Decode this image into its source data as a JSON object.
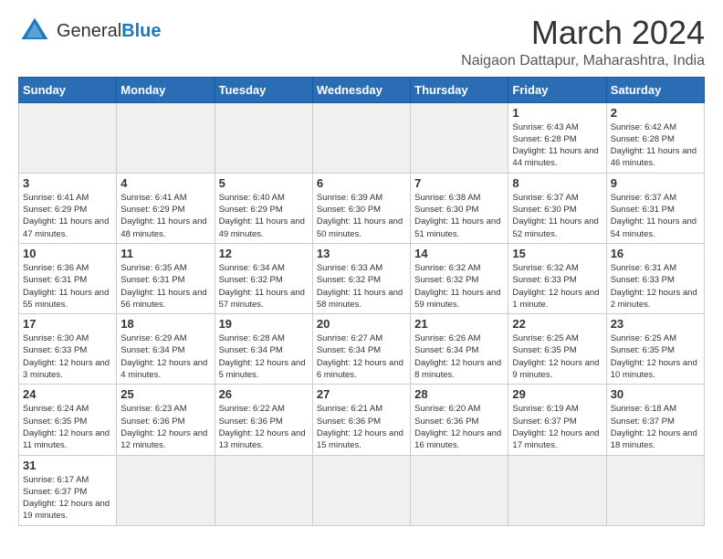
{
  "header": {
    "logo_general": "General",
    "logo_blue": "Blue",
    "month_year": "March 2024",
    "location": "Naigaon Dattapur, Maharashtra, India"
  },
  "days_of_week": [
    "Sunday",
    "Monday",
    "Tuesday",
    "Wednesday",
    "Thursday",
    "Friday",
    "Saturday"
  ],
  "weeks": [
    [
      {
        "day": "",
        "info": ""
      },
      {
        "day": "",
        "info": ""
      },
      {
        "day": "",
        "info": ""
      },
      {
        "day": "",
        "info": ""
      },
      {
        "day": "",
        "info": ""
      },
      {
        "day": "1",
        "info": "Sunrise: 6:43 AM\nSunset: 6:28 PM\nDaylight: 11 hours\nand 44 minutes."
      },
      {
        "day": "2",
        "info": "Sunrise: 6:42 AM\nSunset: 6:28 PM\nDaylight: 11 hours\nand 46 minutes."
      }
    ],
    [
      {
        "day": "3",
        "info": "Sunrise: 6:41 AM\nSunset: 6:29 PM\nDaylight: 11 hours\nand 47 minutes."
      },
      {
        "day": "4",
        "info": "Sunrise: 6:41 AM\nSunset: 6:29 PM\nDaylight: 11 hours\nand 48 minutes."
      },
      {
        "day": "5",
        "info": "Sunrise: 6:40 AM\nSunset: 6:29 PM\nDaylight: 11 hours\nand 49 minutes."
      },
      {
        "day": "6",
        "info": "Sunrise: 6:39 AM\nSunset: 6:30 PM\nDaylight: 11 hours\nand 50 minutes."
      },
      {
        "day": "7",
        "info": "Sunrise: 6:38 AM\nSunset: 6:30 PM\nDaylight: 11 hours\nand 51 minutes."
      },
      {
        "day": "8",
        "info": "Sunrise: 6:37 AM\nSunset: 6:30 PM\nDaylight: 11 hours\nand 52 minutes."
      },
      {
        "day": "9",
        "info": "Sunrise: 6:37 AM\nSunset: 6:31 PM\nDaylight: 11 hours\nand 54 minutes."
      }
    ],
    [
      {
        "day": "10",
        "info": "Sunrise: 6:36 AM\nSunset: 6:31 PM\nDaylight: 11 hours\nand 55 minutes."
      },
      {
        "day": "11",
        "info": "Sunrise: 6:35 AM\nSunset: 6:31 PM\nDaylight: 11 hours\nand 56 minutes."
      },
      {
        "day": "12",
        "info": "Sunrise: 6:34 AM\nSunset: 6:32 PM\nDaylight: 11 hours\nand 57 minutes."
      },
      {
        "day": "13",
        "info": "Sunrise: 6:33 AM\nSunset: 6:32 PM\nDaylight: 11 hours\nand 58 minutes."
      },
      {
        "day": "14",
        "info": "Sunrise: 6:32 AM\nSunset: 6:32 PM\nDaylight: 11 hours\nand 59 minutes."
      },
      {
        "day": "15",
        "info": "Sunrise: 6:32 AM\nSunset: 6:33 PM\nDaylight: 12 hours\nand 1 minute."
      },
      {
        "day": "16",
        "info": "Sunrise: 6:31 AM\nSunset: 6:33 PM\nDaylight: 12 hours\nand 2 minutes."
      }
    ],
    [
      {
        "day": "17",
        "info": "Sunrise: 6:30 AM\nSunset: 6:33 PM\nDaylight: 12 hours\nand 3 minutes."
      },
      {
        "day": "18",
        "info": "Sunrise: 6:29 AM\nSunset: 6:34 PM\nDaylight: 12 hours\nand 4 minutes."
      },
      {
        "day": "19",
        "info": "Sunrise: 6:28 AM\nSunset: 6:34 PM\nDaylight: 12 hours\nand 5 minutes."
      },
      {
        "day": "20",
        "info": "Sunrise: 6:27 AM\nSunset: 6:34 PM\nDaylight: 12 hours\nand 6 minutes."
      },
      {
        "day": "21",
        "info": "Sunrise: 6:26 AM\nSunset: 6:34 PM\nDaylight: 12 hours\nand 8 minutes."
      },
      {
        "day": "22",
        "info": "Sunrise: 6:25 AM\nSunset: 6:35 PM\nDaylight: 12 hours\nand 9 minutes."
      },
      {
        "day": "23",
        "info": "Sunrise: 6:25 AM\nSunset: 6:35 PM\nDaylight: 12 hours\nand 10 minutes."
      }
    ],
    [
      {
        "day": "24",
        "info": "Sunrise: 6:24 AM\nSunset: 6:35 PM\nDaylight: 12 hours\nand 11 minutes."
      },
      {
        "day": "25",
        "info": "Sunrise: 6:23 AM\nSunset: 6:36 PM\nDaylight: 12 hours\nand 12 minutes."
      },
      {
        "day": "26",
        "info": "Sunrise: 6:22 AM\nSunset: 6:36 PM\nDaylight: 12 hours\nand 13 minutes."
      },
      {
        "day": "27",
        "info": "Sunrise: 6:21 AM\nSunset: 6:36 PM\nDaylight: 12 hours\nand 15 minutes."
      },
      {
        "day": "28",
        "info": "Sunrise: 6:20 AM\nSunset: 6:36 PM\nDaylight: 12 hours\nand 16 minutes."
      },
      {
        "day": "29",
        "info": "Sunrise: 6:19 AM\nSunset: 6:37 PM\nDaylight: 12 hours\nand 17 minutes."
      },
      {
        "day": "30",
        "info": "Sunrise: 6:18 AM\nSunset: 6:37 PM\nDaylight: 12 hours\nand 18 minutes."
      }
    ],
    [
      {
        "day": "31",
        "info": "Sunrise: 6:17 AM\nSunset: 6:37 PM\nDaylight: 12 hours\nand 19 minutes."
      },
      {
        "day": "",
        "info": ""
      },
      {
        "day": "",
        "info": ""
      },
      {
        "day": "",
        "info": ""
      },
      {
        "day": "",
        "info": ""
      },
      {
        "day": "",
        "info": ""
      },
      {
        "day": "",
        "info": ""
      }
    ]
  ]
}
